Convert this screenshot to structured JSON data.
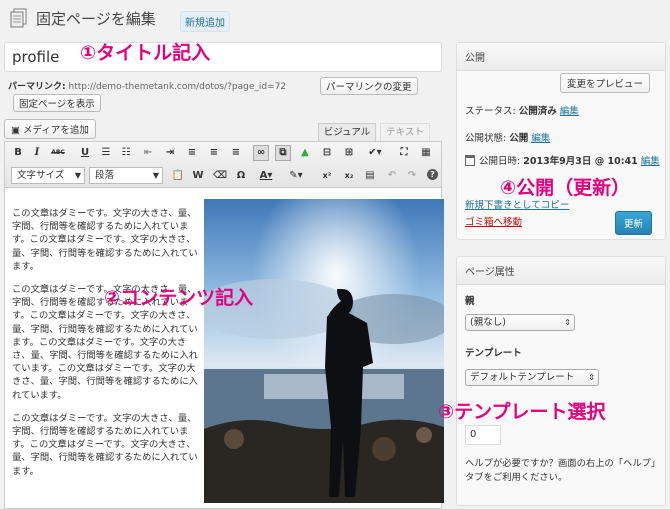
{
  "header": {
    "title": "固定ページを編集",
    "add_new": "新規追加"
  },
  "title_field": {
    "value": "profile"
  },
  "annotations": {
    "a1": "①タイトル記入",
    "a2": "②コンテンツ記入",
    "a3": "③テンプレート選択",
    "a4": "④公開（更新）"
  },
  "permalink": {
    "label": "パーマリンク:",
    "url": "http://demo-themetank.com/dotos/?page_id=72",
    "change_button": "パーマリンクの変更",
    "view_button": "固定ページを表示"
  },
  "media_button": "メディアを追加",
  "editor_tabs": {
    "visual": "ビジュアル",
    "text": "テキスト"
  },
  "toolbar": {
    "format_select": "文字サイズ",
    "paragraph_select": "段落",
    "bold": "B",
    "italic": "I",
    "strike": "ABC",
    "underline": "U"
  },
  "content": {
    "p1": "この文章はダミーです。文字の大きさ、量、字間、行間等を確認するために入れています。この文章はダミーです。文字の大きさ、量、字間、行間等を確認するために入れています。",
    "p2": "この文章はダミーです。文字の大きさ、量、字間、行間等を確認するために入れています。この文章はダミーです。文字の大きさ、量、字間、行間等を確認するために入れています。この文章はダミーです。文字の大きさ、量、字間、行間等を確認するために入れています。この文章はダミーです。文字の大きさ、量、字間、行間等を確認するために入れています。",
    "p3": "この文章はダミーです。文字の大きさ、量、字間、行間等を確認するために入れています。この文章はダミーです。文字の大きさ、量、字間、行間等を確認するために入れています。"
  },
  "publish": {
    "heading": "公開",
    "preview_button": "変更をプレビュー",
    "status_label": "ステータス:",
    "status_value": "公開済み",
    "status_edit": "編集",
    "visibility_label": "公開状態:",
    "visibility_value": "公開",
    "visibility_edit": "編集",
    "date_label": "公開日時:",
    "date_value": "2013年9月3日 @ 10:41",
    "date_edit": "編集",
    "draft_link": "新規下書きとしてコピー",
    "trash_link": "ゴミ箱へ移動",
    "update_button": "更新"
  },
  "page_attributes": {
    "heading": "ページ属性",
    "parent_label": "親",
    "parent_value": "(親なし)",
    "template_label": "テンプレート",
    "template_value": "デフォルトテンプレート",
    "order_value": "0",
    "help": "ヘルプが必要ですか？画面の右上の「ヘルプ」タブをご利用ください。"
  },
  "colors": {
    "annotation": "#e4007f",
    "link": "#21759b",
    "trash": "#bc0b0b",
    "primary": "#2683b4"
  }
}
